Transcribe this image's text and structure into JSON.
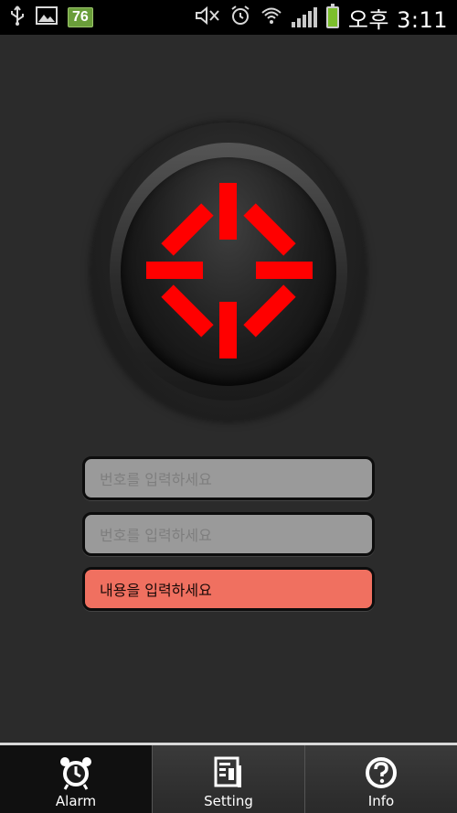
{
  "status_bar": {
    "battery_level": "76",
    "time": "오후 3:11",
    "icons": [
      "usb-icon",
      "image-icon",
      "battery-badge",
      "mute-icon",
      "alarm-clock-icon",
      "wifi-icon",
      "signal-icon",
      "battery-icon"
    ]
  },
  "main_button": {
    "icon": "spinner-icon",
    "accent_color": "#ff0000"
  },
  "form": {
    "phone_input_1": {
      "placeholder": "번호를 입력하세요"
    },
    "phone_input_2": {
      "placeholder": "번호를 입력하세요"
    },
    "message_input": {
      "placeholder": "내용을 입력하세요",
      "accent_color": "#f07060"
    }
  },
  "tabbar": {
    "tabs": [
      {
        "label": "Alarm",
        "icon": "alarm-clock-icon",
        "active": true
      },
      {
        "label": "Setting",
        "icon": "document-icon",
        "active": false
      },
      {
        "label": "Info",
        "icon": "question-icon",
        "active": false
      }
    ]
  }
}
